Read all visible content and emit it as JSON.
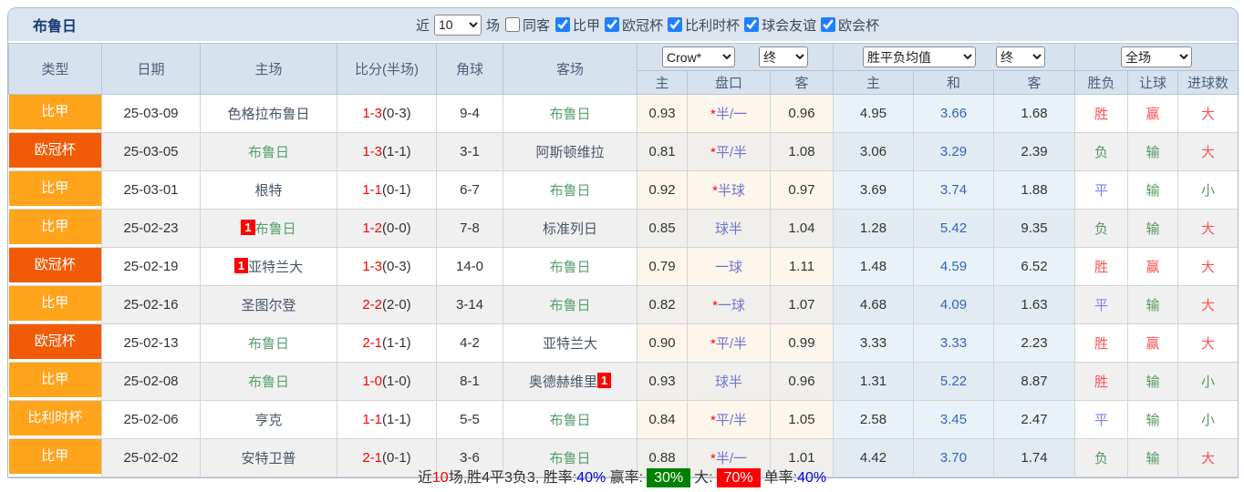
{
  "header": {
    "title": "布鲁日",
    "controls": {
      "recent_label": "近",
      "recent_value": "10",
      "unit_label": "场",
      "same_venue_label": "同客",
      "same_venue_checked": false,
      "filters": [
        {
          "label": "比甲",
          "checked": true
        },
        {
          "label": "欧冠杯",
          "checked": true
        },
        {
          "label": "比利时杯",
          "checked": true
        },
        {
          "label": "球会友谊",
          "checked": true
        },
        {
          "label": "欧会杯",
          "checked": true
        }
      ]
    }
  },
  "table": {
    "columns": [
      "类型",
      "日期",
      "主场",
      "比分(半场)",
      "角球",
      "客场"
    ],
    "groups": {
      "odds_source_select": "Crow*",
      "odds_state_select": "终",
      "odds_sub": [
        "主",
        "盘口",
        "客"
      ],
      "avg_select": "胜平负均值",
      "avg_state_select": "终",
      "avg_sub": [
        "主",
        "和",
        "客"
      ],
      "scope_select": "全场",
      "result_sub": [
        "胜负",
        "让球",
        "进球数"
      ]
    },
    "league_colors": {
      "比甲": "#ffa41b",
      "欧冠杯": "#f25b05",
      "比利时杯": "#ffa41b"
    },
    "subject_team": "布鲁日",
    "rows": [
      {
        "league": "比甲",
        "date": "25-03-09",
        "home": "色格拉布鲁日",
        "home_is_subject": false,
        "home_badge": "",
        "score_ft": "1-3",
        "score_ht": "(0-3)",
        "corners": "9-4",
        "away": "布鲁日",
        "away_is_subject": true,
        "away_badge": "",
        "odds_home": "0.93",
        "handicap_star": "*",
        "handicap": "半/一",
        "odds_away": "0.96",
        "avg_home": "4.95",
        "avg_draw": "3.66",
        "avg_away": "1.68",
        "result_wdl": "胜",
        "result_handicap": "赢",
        "result_goals": "大"
      },
      {
        "league": "欧冠杯",
        "date": "25-03-05",
        "home": "布鲁日",
        "home_is_subject": true,
        "home_badge": "",
        "score_ft": "1-3",
        "score_ht": "(1-1)",
        "corners": "3-1",
        "away": "阿斯顿维拉",
        "away_is_subject": false,
        "away_badge": "",
        "odds_home": "0.81",
        "handicap_star": "*",
        "handicap": "平/半",
        "odds_away": "1.08",
        "avg_home": "3.06",
        "avg_draw": "3.29",
        "avg_away": "2.39",
        "result_wdl": "负",
        "result_handicap": "输",
        "result_goals": "大"
      },
      {
        "league": "比甲",
        "date": "25-03-01",
        "home": "根特",
        "home_is_subject": false,
        "home_badge": "",
        "score_ft": "1-1",
        "score_ht": "(0-1)",
        "corners": "6-7",
        "away": "布鲁日",
        "away_is_subject": true,
        "away_badge": "",
        "odds_home": "0.92",
        "handicap_star": "*",
        "handicap": "半球",
        "odds_away": "0.97",
        "avg_home": "3.69",
        "avg_draw": "3.74",
        "avg_away": "1.88",
        "result_wdl": "平",
        "result_handicap": "输",
        "result_goals": "小"
      },
      {
        "league": "比甲",
        "date": "25-02-23",
        "home": "布鲁日",
        "home_is_subject": true,
        "home_badge": "1",
        "score_ft": "1-2",
        "score_ht": "(0-0)",
        "corners": "7-8",
        "away": "标准列日",
        "away_is_subject": false,
        "away_badge": "",
        "odds_home": "0.85",
        "handicap_star": "",
        "handicap": "球半",
        "odds_away": "1.04",
        "avg_home": "1.28",
        "avg_draw": "5.42",
        "avg_away": "9.35",
        "result_wdl": "负",
        "result_handicap": "输",
        "result_goals": "大"
      },
      {
        "league": "欧冠杯",
        "date": "25-02-19",
        "home": "亚特兰大",
        "home_is_subject": false,
        "home_badge": "1",
        "score_ft": "1-3",
        "score_ht": "(0-3)",
        "corners": "14-0",
        "away": "布鲁日",
        "away_is_subject": true,
        "away_badge": "",
        "odds_home": "0.79",
        "handicap_star": "",
        "handicap": "一球",
        "odds_away": "1.11",
        "avg_home": "1.48",
        "avg_draw": "4.59",
        "avg_away": "6.52",
        "result_wdl": "胜",
        "result_handicap": "赢",
        "result_goals": "大"
      },
      {
        "league": "比甲",
        "date": "25-02-16",
        "home": "圣图尔登",
        "home_is_subject": false,
        "home_badge": "",
        "score_ft": "2-2",
        "score_ht": "(2-0)",
        "corners": "3-14",
        "away": "布鲁日",
        "away_is_subject": true,
        "away_badge": "",
        "odds_home": "0.82",
        "handicap_star": "*",
        "handicap": "一球",
        "odds_away": "1.07",
        "avg_home": "4.68",
        "avg_draw": "4.09",
        "avg_away": "1.63",
        "result_wdl": "平",
        "result_handicap": "输",
        "result_goals": "大"
      },
      {
        "league": "欧冠杯",
        "date": "25-02-13",
        "home": "布鲁日",
        "home_is_subject": true,
        "home_badge": "",
        "score_ft": "2-1",
        "score_ht": "(1-1)",
        "corners": "4-2",
        "away": "亚特兰大",
        "away_is_subject": false,
        "away_badge": "",
        "odds_home": "0.90",
        "handicap_star": "*",
        "handicap": "平/半",
        "odds_away": "0.99",
        "avg_home": "3.33",
        "avg_draw": "3.33",
        "avg_away": "2.23",
        "result_wdl": "胜",
        "result_handicap": "赢",
        "result_goals": "大"
      },
      {
        "league": "比甲",
        "date": "25-02-08",
        "home": "布鲁日",
        "home_is_subject": true,
        "home_badge": "",
        "score_ft": "1-0",
        "score_ht": "(1-0)",
        "corners": "8-1",
        "away": "奥德赫维里",
        "away_is_subject": false,
        "away_badge": "1",
        "odds_home": "0.93",
        "handicap_star": "",
        "handicap": "球半",
        "odds_away": "0.96",
        "avg_home": "1.31",
        "avg_draw": "5.22",
        "avg_away": "8.87",
        "result_wdl": "胜",
        "result_handicap": "输",
        "result_goals": "小"
      },
      {
        "league": "比利时杯",
        "date": "25-02-06",
        "home": "亨克",
        "home_is_subject": false,
        "home_badge": "",
        "score_ft": "1-1",
        "score_ht": "(1-1)",
        "corners": "5-5",
        "away": "布鲁日",
        "away_is_subject": true,
        "away_badge": "",
        "odds_home": "0.84",
        "handicap_star": "*",
        "handicap": "平/半",
        "odds_away": "1.05",
        "avg_home": "2.58",
        "avg_draw": "3.45",
        "avg_away": "2.47",
        "result_wdl": "平",
        "result_handicap": "输",
        "result_goals": "小"
      },
      {
        "league": "比甲",
        "date": "25-02-02",
        "home": "安特卫普",
        "home_is_subject": false,
        "home_badge": "",
        "score_ft": "2-1",
        "score_ht": "(0-1)",
        "corners": "3-6",
        "away": "布鲁日",
        "away_is_subject": true,
        "away_badge": "",
        "odds_home": "0.88",
        "handicap_star": "*",
        "handicap": "半/一",
        "odds_away": "1.01",
        "avg_home": "4.42",
        "avg_draw": "3.70",
        "avg_away": "1.74",
        "result_wdl": "负",
        "result_handicap": "输",
        "result_goals": "大"
      }
    ]
  },
  "footer": {
    "recent_label": "近",
    "recent_count": "10",
    "record_text": "场,胜4平3负3, 胜率:",
    "win_rate": "40%",
    "handicap_label": " 赢率:",
    "handicap_rate": "30%",
    "goals_label": "大:",
    "goals_rate": "70%",
    "single_label": "单率:",
    "single_rate": "40%"
  },
  "colors": {
    "score_red": "#ff0000",
    "rate_blue": "#0000ee",
    "win_bg_green": "#008000",
    "big_bg_red": "#ff0000",
    "subject_team_green": "#55a06e",
    "league_orange": "#ffa41b",
    "league_deep_orange": "#f25b05",
    "result_red": "#ff5252",
    "result_green": "#55995f",
    "result_blue": "#7d7dfd"
  }
}
